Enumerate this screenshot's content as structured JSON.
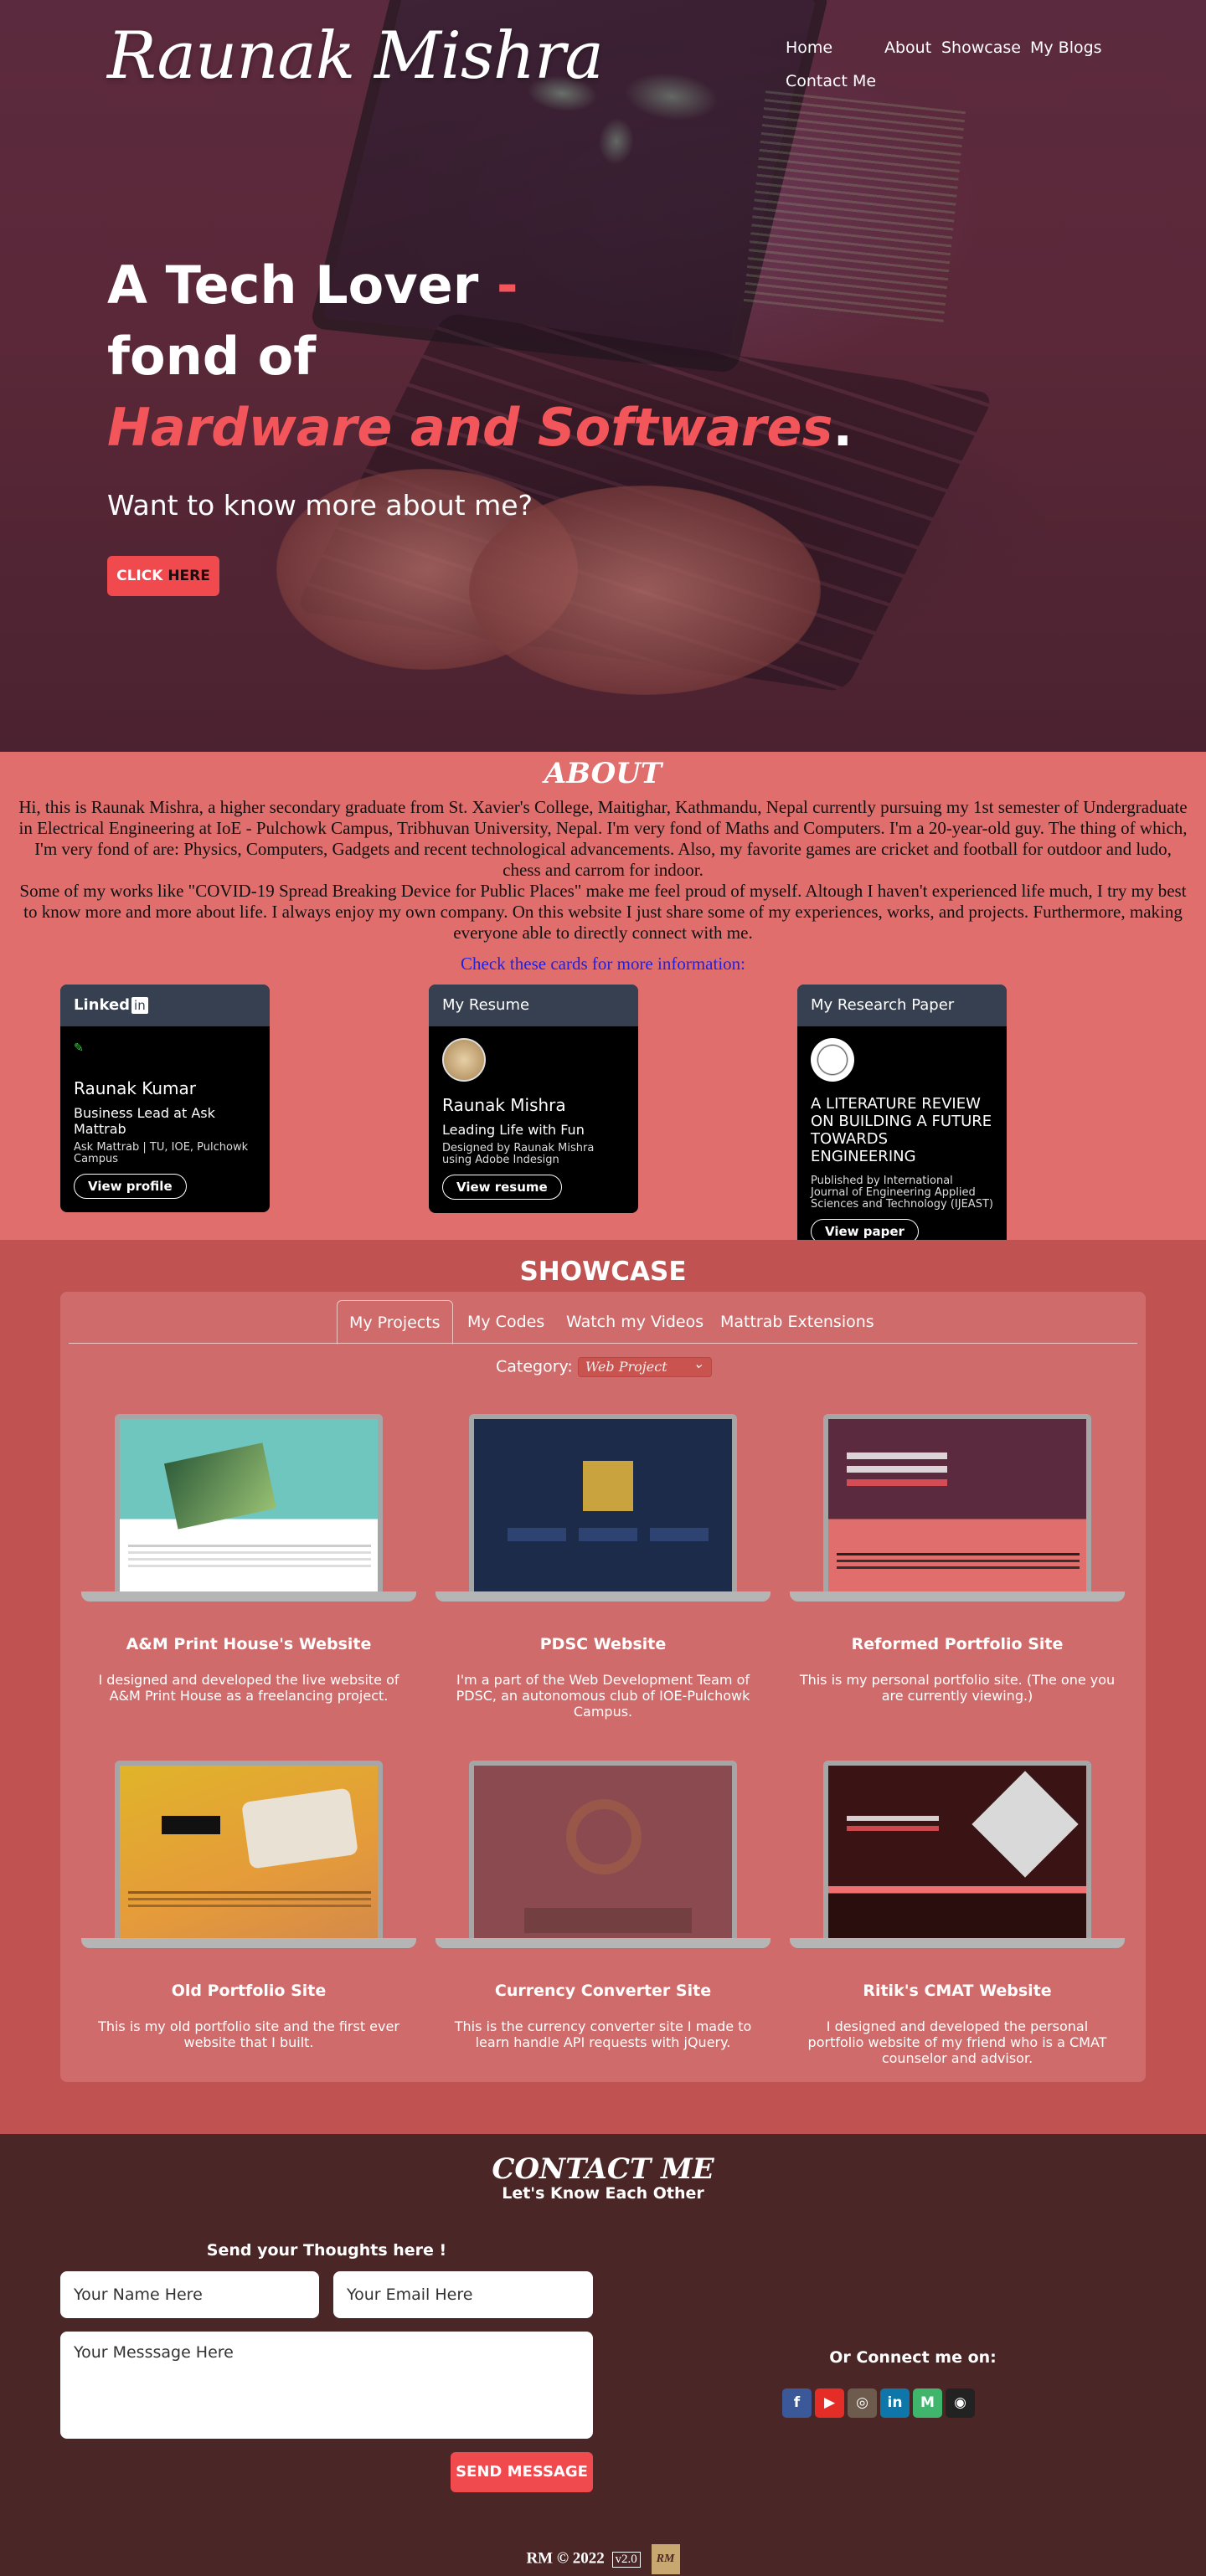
{
  "brand": {
    "logo_text": "Raunak Mishra"
  },
  "nav": [
    {
      "label": "Home"
    },
    {
      "label": "About"
    },
    {
      "label": "Showcase"
    },
    {
      "label": "My Blogs"
    },
    {
      "label": "Contact Me"
    }
  ],
  "hero": {
    "line1": "A Tech Lover",
    "dash": " -",
    "line2": "fond of",
    "accent": "Hardware and Softwares",
    "period": ".",
    "subtitle": "Want to know more about me?",
    "cta_part1": "CLICK ",
    "cta_part2": "HERE"
  },
  "about": {
    "title": "ABOUT",
    "paragraph1": "Hi, this is Raunak Mishra, a higher secondary graduate from St. Xavier's College, Maitighar, Kathmandu, Nepal currently pursuing my 1st semester of Undergraduate in Electrical Engineering at IoE - Pulchowk Campus, Tribhuvan University, Nepal. I'm very fond of Maths and Computers. I'm a 20-year-old guy. The thing of which, I'm very fond of are: Physics, Computers, Gadgets and recent technological advancements. Also, my favorite games are cricket and football for outdoor and ludo, chess and carrom for indoor.",
    "paragraph2": "Some of my works like \"COVID-19 Spread Breaking Device for Public Places\" make me feel proud of myself. Altough I haven't experienced life much, I try my best to know more and more about life. I always enjoy my own company. On this website I just share some of my experiences, works, and projects. Furthermore, making everyone able to directly connect with me.",
    "cards_hint": "Check these cards for more information:",
    "cards": [
      {
        "header_prefix": "Linked",
        "header_box": "in",
        "name": "Raunak Kumar",
        "role": "Business Lead at Ask Mattrab",
        "desc": "Ask Mattrab | TU, IOE, Pulchowk Campus",
        "button": "View profile"
      },
      {
        "header": "My Resume",
        "name": "Raunak Mishra",
        "role": "Leading Life with Fun",
        "desc": "Designed by Raunak Mishra using Adobe Indesign",
        "button": "View resume"
      },
      {
        "header": "My Research Paper",
        "name": "A LITERATURE REVIEW ON BUILDING A FUTURE TOWARDS ENGINEERING",
        "desc": "Published by International Journal of Engineering Applied Sciences and Technology (IJEAST)",
        "button": "View paper"
      }
    ]
  },
  "showcase": {
    "title": "SHOWCASE",
    "tabs": [
      {
        "label": "My Projects",
        "active": true
      },
      {
        "label": "My Codes"
      },
      {
        "label": "Watch my Videos"
      },
      {
        "label": "Mattrab Extensions"
      }
    ],
    "category_label": "Category:",
    "category_value": "Web Project",
    "projects": [
      {
        "title": "A&M Print House's Website",
        "desc": "I designed and developed the live website of A&M Print House as a freelancing project."
      },
      {
        "title": "PDSC Website",
        "desc": "I'm a part of the Web Development Team of PDSC, an autonomous club of IOE-Pulchowk Campus."
      },
      {
        "title": "Reformed Portfolio Site",
        "desc": "This is my personal portfolio site. (The one you are currently viewing.)"
      },
      {
        "title": "Old Portfolio Site",
        "desc": "This is my old portfolio site and the first ever website that I built."
      },
      {
        "title": "Currency Converter Site",
        "desc": "This is the currency converter site I made to learn handle API requests with jQuery."
      },
      {
        "title": "Ritik's CMAT Website",
        "desc": "I designed and developed the personal portfolio website of my friend who is a CMAT counselor and advisor."
      }
    ]
  },
  "contact": {
    "title": "CONTACT ME",
    "subtitle": "Let's Know Each Other",
    "form_title": "Send your Thoughts here !",
    "name_placeholder": "Your Name Here",
    "email_placeholder": "Your Email Here",
    "message_placeholder": "Your Messsage Here",
    "send_label": "SEND MESSAGE",
    "connect_label": "Or Connect me on:",
    "socials": [
      {
        "icon": "facebook-icon",
        "glyph": "f",
        "color": "#3b5998"
      },
      {
        "icon": "youtube-icon",
        "glyph": "▶",
        "color": "#e52d27"
      },
      {
        "icon": "instagram-icon",
        "glyph": "◎",
        "color": "#6d5c4e"
      },
      {
        "icon": "linkedin-icon",
        "glyph": "in",
        "color": "#0e76a8"
      },
      {
        "icon": "medium-icon",
        "glyph": "M",
        "color": "#3fb66b"
      },
      {
        "icon": "github-icon",
        "glyph": "◉",
        "color": "#222222"
      }
    ]
  },
  "footer": {
    "text": "RM © 2022",
    "version": "v2.0",
    "logo_text": "RM"
  }
}
